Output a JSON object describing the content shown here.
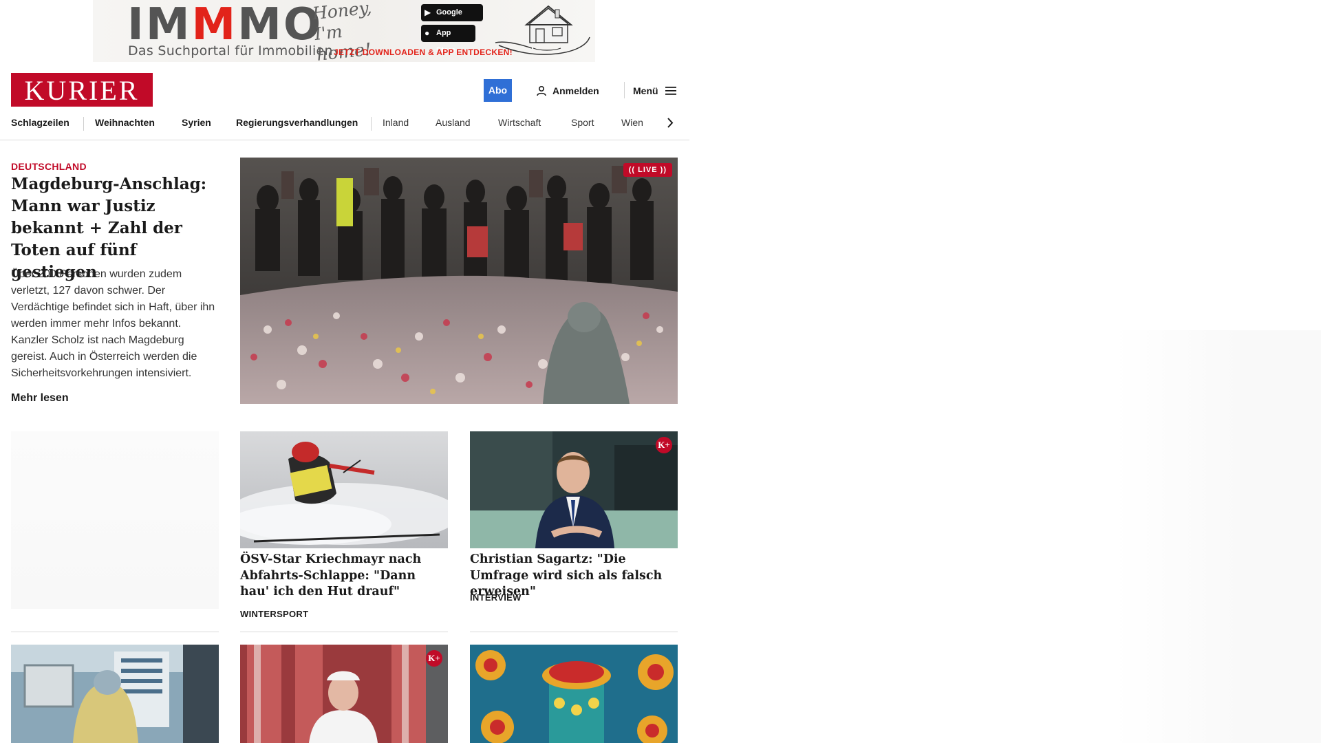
{
  "ad": {
    "brand_part1": "IM",
    "brand_m": "M",
    "brand_part2": "MO",
    "tagline": "Das Suchportal für Immobilien",
    "script_text": "Honey, I'm home!",
    "google_play": "Google Play",
    "app_store": "App Store",
    "cta": "JETZT DOWNLOADEN & APP ENTDECKEN!"
  },
  "header": {
    "logo": "KURIER",
    "abo": "Abo",
    "login": "Anmelden",
    "menu": "Menü"
  },
  "nav": {
    "items": [
      "Schlagzeilen",
      "Weihnachten",
      "Syrien",
      "Regierungsverhandlungen",
      "Inland",
      "Ausland",
      "Wirtschaft",
      "Sport",
      "Wien"
    ]
  },
  "lead": {
    "kicker": "DEUTSCHLAND",
    "title": "Magdeburg-Anschlag: Mann war Justiz bekannt + Zahl der Toten auf fünf gestiegen",
    "teaser": "Über 200 Personen wurden zudem verletzt, 127 davon schwer. Der Verdächtige befindet sich in Haft, über ihn werden immer mehr Infos bekannt. Kanzler Scholz ist nach Magdeburg gereist. Auch in Österreich werden die Sicherheitsvorkehrungen intensiviert.",
    "more": "Mehr lesen",
    "badge": "LIVE"
  },
  "cards": [
    {
      "title": "ÖSV-Star Kriechmayr nach Ab­fahrts-Schlappe: \"Dann hau' ich den Hut drauf\"",
      "kicker": "WINTERSPORT"
    },
    {
      "title": "Christian Sagartz: \"Die Umfrage wird sich als falsch erweisen\"",
      "kicker": "INTERVIEW",
      "premium": "K+"
    }
  ],
  "bottom_row": {
    "premium": "K+"
  },
  "colors": {
    "brand_red": "#c10a28",
    "abo_blue": "#2f6fd6"
  }
}
